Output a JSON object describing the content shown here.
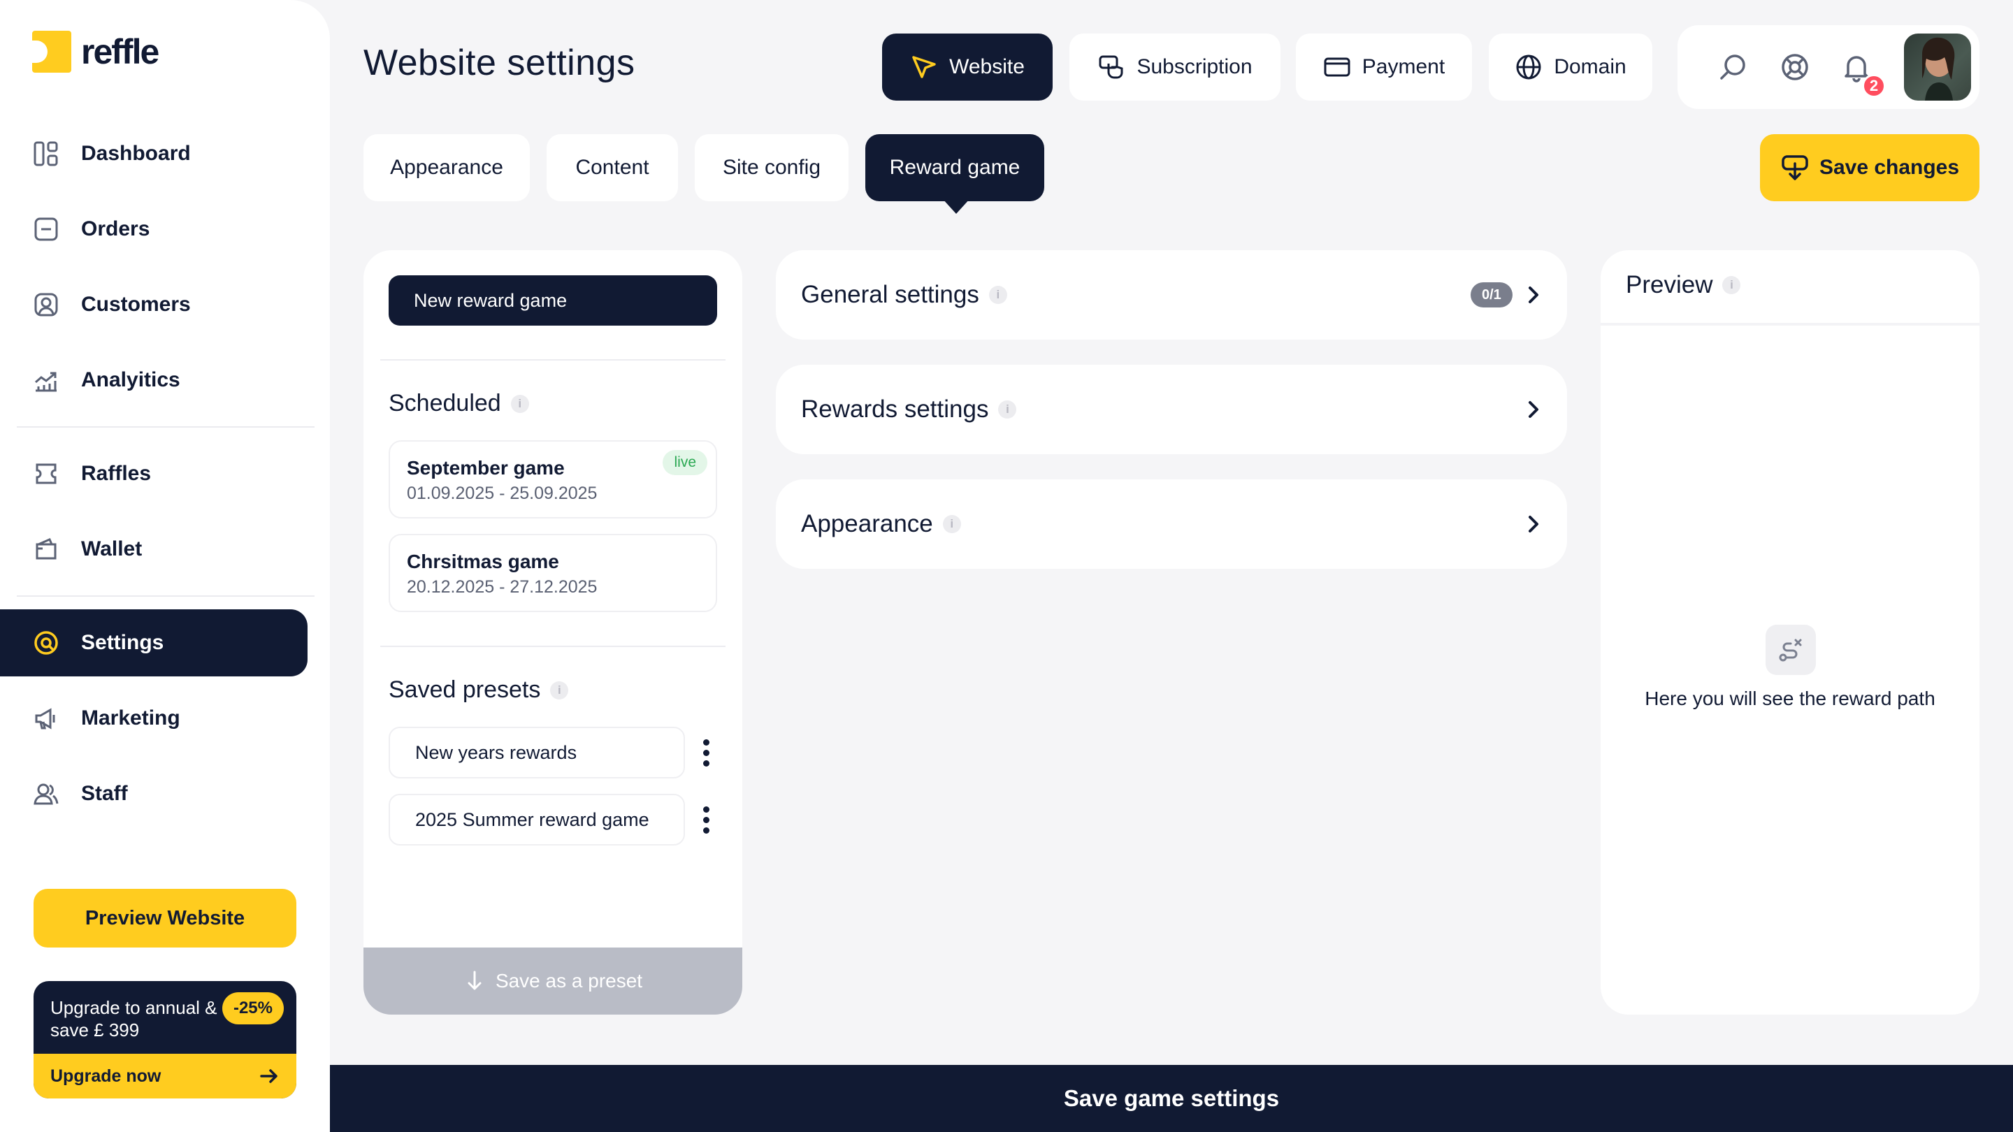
{
  "brand": {
    "name": "reffle",
    "accent": "#ffcc1f",
    "navy": "#111a33"
  },
  "sidebar": {
    "items": [
      {
        "label": "Dashboard",
        "icon": "dashboard-icon"
      },
      {
        "label": "Orders",
        "icon": "orders-icon"
      },
      {
        "label": "Customers",
        "icon": "customers-icon"
      },
      {
        "label": "Analyitics",
        "icon": "analytics-icon"
      },
      {
        "label": "Raffles",
        "icon": "ticket-icon"
      },
      {
        "label": "Wallet",
        "icon": "wallet-icon"
      },
      {
        "label": "Settings",
        "icon": "settings-icon",
        "active": true
      },
      {
        "label": "Marketing",
        "icon": "megaphone-icon"
      },
      {
        "label": "Staff",
        "icon": "staff-icon"
      }
    ],
    "preview_button": "Preview Website",
    "upgrade": {
      "text": "Upgrade to annual & save £ 399",
      "badge": "-25%",
      "cta": "Upgrade now"
    }
  },
  "header": {
    "title": "Website settings",
    "tabs": [
      {
        "label": "Website",
        "icon": "cursor-icon",
        "active": true
      },
      {
        "label": "Subscription",
        "icon": "subscription-icon"
      },
      {
        "label": "Payment",
        "icon": "card-icon"
      },
      {
        "label": "Domain",
        "icon": "globe-icon"
      }
    ],
    "notification_count": "2"
  },
  "sub_tabs": [
    {
      "label": "Appearance"
    },
    {
      "label": "Content"
    },
    {
      "label": "Site config"
    },
    {
      "label": "Reward game",
      "active": true
    }
  ],
  "save_changes": "Save changes",
  "games_panel": {
    "new_button": "New reward game",
    "scheduled_title": "Scheduled",
    "scheduled": [
      {
        "name": "September game",
        "dates": "01.09.2025 - 25.09.2025",
        "status": "live"
      },
      {
        "name": "Chrsitmas game",
        "dates": "20.12.2025 - 27.12.2025"
      }
    ],
    "presets_title": "Saved presets",
    "presets": [
      {
        "name": "New years rewards"
      },
      {
        "name": "2025 Summer reward game"
      }
    ],
    "save_preset": "Save as a preset"
  },
  "accordion": [
    {
      "title": "General settings",
      "count": "0/1"
    },
    {
      "title": "Rewards settings"
    },
    {
      "title": "Appearance"
    }
  ],
  "preview": {
    "title": "Preview",
    "empty_text": "Here you will see the reward path"
  },
  "bottom_bar": "Save game settings"
}
